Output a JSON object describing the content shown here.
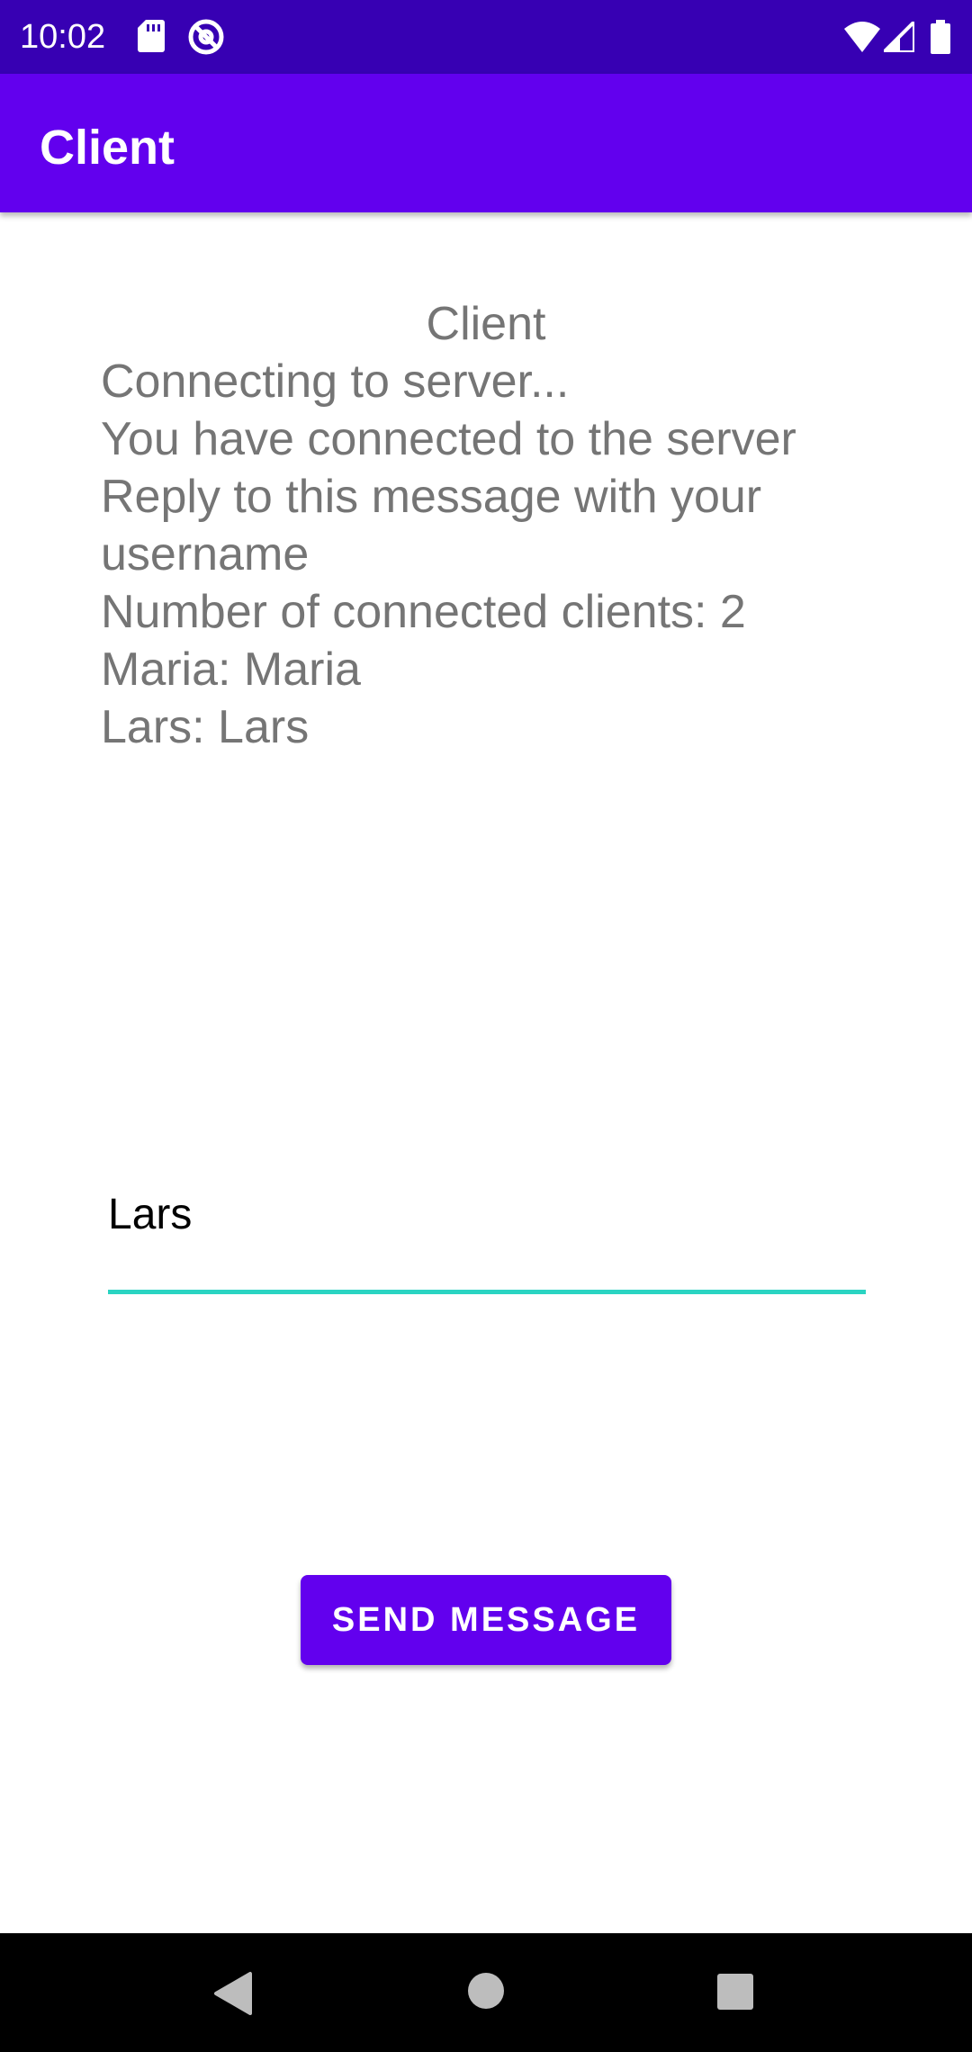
{
  "status_bar": {
    "time": "10:02",
    "icons_left": [
      "sd-card-icon",
      "at-sign-icon"
    ],
    "icons_right": [
      "wifi-icon",
      "cell-signal-icon",
      "battery-icon"
    ],
    "background": "#3700b3"
  },
  "app_bar": {
    "title": "Client",
    "background": "#6200ee"
  },
  "log": {
    "heading": "Client",
    "lines": [
      "Connecting to server...",
      "You have connected to the server",
      "Reply to this message with your username",
      "Number of connected clients: 2",
      "Maria: Maria",
      "Lars: Lars"
    ],
    "text_color": "#757575"
  },
  "message_input": {
    "value": "Lars",
    "underline_color": "#2ad4c2"
  },
  "send_button": {
    "label": "SEND MESSAGE",
    "background": "#6200ee"
  },
  "nav_bar": {
    "buttons": [
      "back-icon",
      "home-icon",
      "recents-icon"
    ]
  }
}
